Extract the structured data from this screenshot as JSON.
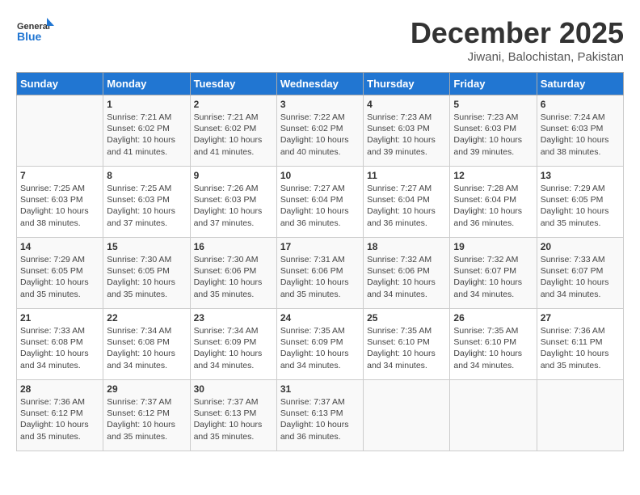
{
  "header": {
    "logo_general": "General",
    "logo_blue": "Blue",
    "title": "December 2025",
    "location": "Jiwani, Balochistan, Pakistan"
  },
  "columns": [
    "Sunday",
    "Monday",
    "Tuesday",
    "Wednesday",
    "Thursday",
    "Friday",
    "Saturday"
  ],
  "weeks": [
    [
      {
        "day": "",
        "info": ""
      },
      {
        "day": "1",
        "info": "Sunrise: 7:21 AM\nSunset: 6:02 PM\nDaylight: 10 hours\nand 41 minutes."
      },
      {
        "day": "2",
        "info": "Sunrise: 7:21 AM\nSunset: 6:02 PM\nDaylight: 10 hours\nand 41 minutes."
      },
      {
        "day": "3",
        "info": "Sunrise: 7:22 AM\nSunset: 6:02 PM\nDaylight: 10 hours\nand 40 minutes."
      },
      {
        "day": "4",
        "info": "Sunrise: 7:23 AM\nSunset: 6:03 PM\nDaylight: 10 hours\nand 39 minutes."
      },
      {
        "day": "5",
        "info": "Sunrise: 7:23 AM\nSunset: 6:03 PM\nDaylight: 10 hours\nand 39 minutes."
      },
      {
        "day": "6",
        "info": "Sunrise: 7:24 AM\nSunset: 6:03 PM\nDaylight: 10 hours\nand 38 minutes."
      }
    ],
    [
      {
        "day": "7",
        "info": "Sunrise: 7:25 AM\nSunset: 6:03 PM\nDaylight: 10 hours\nand 38 minutes."
      },
      {
        "day": "8",
        "info": "Sunrise: 7:25 AM\nSunset: 6:03 PM\nDaylight: 10 hours\nand 37 minutes."
      },
      {
        "day": "9",
        "info": "Sunrise: 7:26 AM\nSunset: 6:03 PM\nDaylight: 10 hours\nand 37 minutes."
      },
      {
        "day": "10",
        "info": "Sunrise: 7:27 AM\nSunset: 6:04 PM\nDaylight: 10 hours\nand 36 minutes."
      },
      {
        "day": "11",
        "info": "Sunrise: 7:27 AM\nSunset: 6:04 PM\nDaylight: 10 hours\nand 36 minutes."
      },
      {
        "day": "12",
        "info": "Sunrise: 7:28 AM\nSunset: 6:04 PM\nDaylight: 10 hours\nand 36 minutes."
      },
      {
        "day": "13",
        "info": "Sunrise: 7:29 AM\nSunset: 6:05 PM\nDaylight: 10 hours\nand 35 minutes."
      }
    ],
    [
      {
        "day": "14",
        "info": "Sunrise: 7:29 AM\nSunset: 6:05 PM\nDaylight: 10 hours\nand 35 minutes."
      },
      {
        "day": "15",
        "info": "Sunrise: 7:30 AM\nSunset: 6:05 PM\nDaylight: 10 hours\nand 35 minutes."
      },
      {
        "day": "16",
        "info": "Sunrise: 7:30 AM\nSunset: 6:06 PM\nDaylight: 10 hours\nand 35 minutes."
      },
      {
        "day": "17",
        "info": "Sunrise: 7:31 AM\nSunset: 6:06 PM\nDaylight: 10 hours\nand 35 minutes."
      },
      {
        "day": "18",
        "info": "Sunrise: 7:32 AM\nSunset: 6:06 PM\nDaylight: 10 hours\nand 34 minutes."
      },
      {
        "day": "19",
        "info": "Sunrise: 7:32 AM\nSunset: 6:07 PM\nDaylight: 10 hours\nand 34 minutes."
      },
      {
        "day": "20",
        "info": "Sunrise: 7:33 AM\nSunset: 6:07 PM\nDaylight: 10 hours\nand 34 minutes."
      }
    ],
    [
      {
        "day": "21",
        "info": "Sunrise: 7:33 AM\nSunset: 6:08 PM\nDaylight: 10 hours\nand 34 minutes."
      },
      {
        "day": "22",
        "info": "Sunrise: 7:34 AM\nSunset: 6:08 PM\nDaylight: 10 hours\nand 34 minutes."
      },
      {
        "day": "23",
        "info": "Sunrise: 7:34 AM\nSunset: 6:09 PM\nDaylight: 10 hours\nand 34 minutes."
      },
      {
        "day": "24",
        "info": "Sunrise: 7:35 AM\nSunset: 6:09 PM\nDaylight: 10 hours\nand 34 minutes."
      },
      {
        "day": "25",
        "info": "Sunrise: 7:35 AM\nSunset: 6:10 PM\nDaylight: 10 hours\nand 34 minutes."
      },
      {
        "day": "26",
        "info": "Sunrise: 7:35 AM\nSunset: 6:10 PM\nDaylight: 10 hours\nand 34 minutes."
      },
      {
        "day": "27",
        "info": "Sunrise: 7:36 AM\nSunset: 6:11 PM\nDaylight: 10 hours\nand 35 minutes."
      }
    ],
    [
      {
        "day": "28",
        "info": "Sunrise: 7:36 AM\nSunset: 6:12 PM\nDaylight: 10 hours\nand 35 minutes."
      },
      {
        "day": "29",
        "info": "Sunrise: 7:37 AM\nSunset: 6:12 PM\nDaylight: 10 hours\nand 35 minutes."
      },
      {
        "day": "30",
        "info": "Sunrise: 7:37 AM\nSunset: 6:13 PM\nDaylight: 10 hours\nand 35 minutes."
      },
      {
        "day": "31",
        "info": "Sunrise: 7:37 AM\nSunset: 6:13 PM\nDaylight: 10 hours\nand 36 minutes."
      },
      {
        "day": "",
        "info": ""
      },
      {
        "day": "",
        "info": ""
      },
      {
        "day": "",
        "info": ""
      }
    ]
  ]
}
